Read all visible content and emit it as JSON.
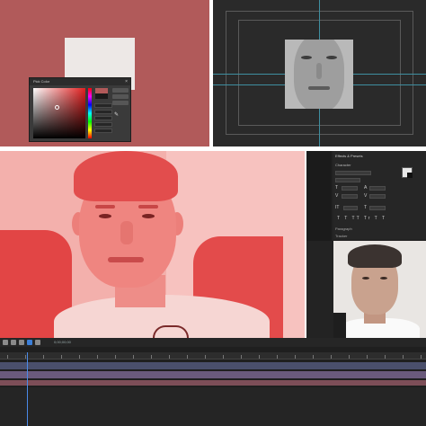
{
  "color_picker": {
    "title": "Pick Color",
    "close_glyph": "×",
    "icons": [
      "eyedropper-icon"
    ]
  },
  "effects_panel": {
    "title": "Effects & Presets",
    "section_character": "Character",
    "section_paragraph": "Paragraph",
    "section_tracker": "Tracker",
    "font_name": "",
    "font_style": "",
    "icons": [
      "text-size-icon",
      "tracking-icon",
      "leading-icon",
      "kerning-icon"
    ]
  },
  "timeline": {
    "timecode": "0;00;00;00",
    "icons": [
      "search-icon",
      "comp-flowchart-icon",
      "draft-3d-icon",
      "motion-blur-icon",
      "graph-editor-icon"
    ]
  },
  "colors": {
    "canvas_bg": "#b15a5a",
    "viewer_bg": "#2a2a2a",
    "guide_line": "#3f8fa0",
    "red_tint": "#ef8580",
    "timeline_track_1": "#4a4f6c",
    "timeline_track_2": "#6a5a7c",
    "timeline_track_3": "#7d4e58"
  }
}
